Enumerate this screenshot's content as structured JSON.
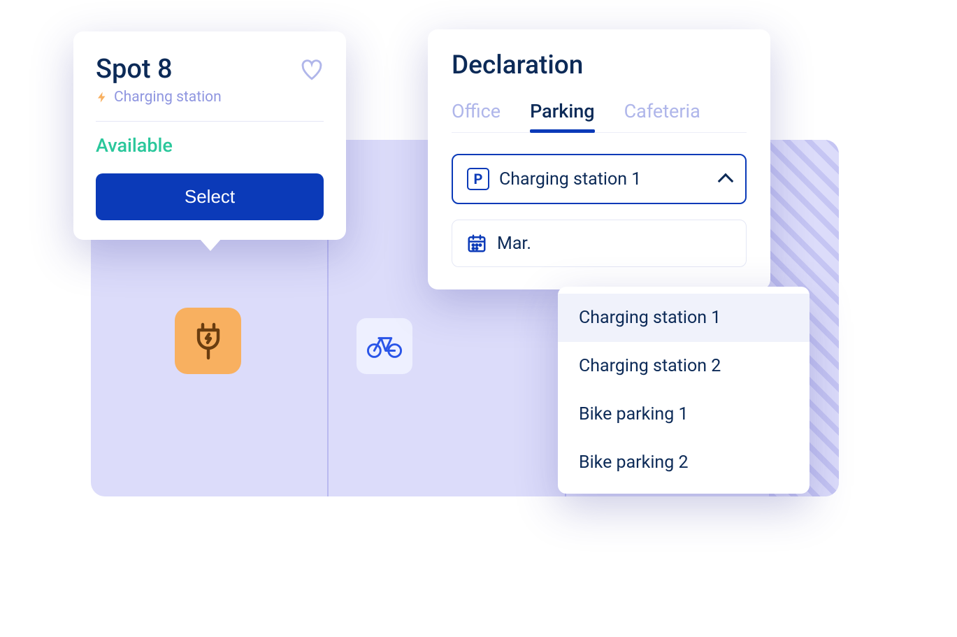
{
  "spot": {
    "title": "Spot 8",
    "subtype": "Charging station",
    "status": "Available",
    "select_label": "Select"
  },
  "declaration": {
    "title": "Declaration",
    "tabs": {
      "office": "Office",
      "parking": "Parking",
      "cafeteria": "Cafeteria"
    },
    "parking_select": "Charging station 1",
    "parking_icon_letter": "P",
    "date_value": "Mar.",
    "dropdown": {
      "opt0": "Charging station 1",
      "opt1": "Charging station 2",
      "opt2": "Bike parking 1",
      "opt3": "Bike parking 2"
    }
  }
}
